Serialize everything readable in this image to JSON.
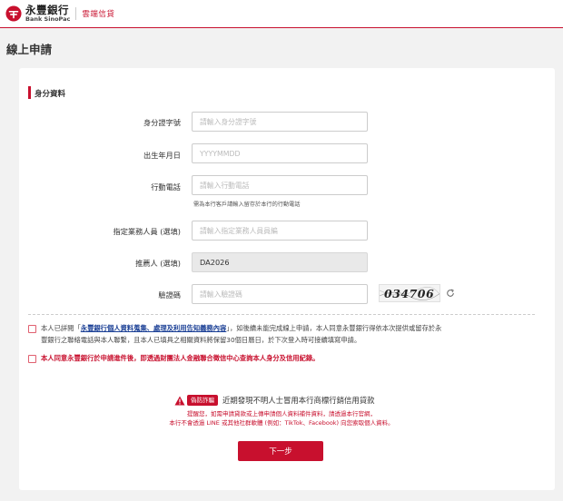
{
  "header": {
    "brand_cn": "永豐銀行",
    "brand_en": "Bank SinoPac",
    "sub_brand": "雲端信貸",
    "logo_icon": "sinopac-logo-icon",
    "accent_color": "#c8102e"
  },
  "page_title": "線上申請",
  "section": {
    "title": "身分資料"
  },
  "form": {
    "id_number": {
      "label": "身分證字號",
      "placeholder": "請輸入身分證字號"
    },
    "birth_date": {
      "label": "出生年月日",
      "placeholder": "YYYYMMDD"
    },
    "mobile": {
      "label": "行動電話",
      "placeholder": "請輸入行動電話",
      "hint": "需為本行客戶請輸入留存於本行的行動電話"
    },
    "agent": {
      "label": "指定業務人員 (選填)",
      "placeholder": "請輸入指定業務人員員編"
    },
    "referrer": {
      "label": "推薦人 (選填)",
      "value": "DA2026"
    },
    "captcha": {
      "label": "驗證碼",
      "placeholder": "請輸入驗證碼",
      "image_text": "034706",
      "refresh_icon": "refresh-icon"
    }
  },
  "consent": {
    "c1_prefix": "本人已詳閱「",
    "c1_link": "永豐銀行個人資料蒐集、處理及利用告知義務內容",
    "c1_suffix": "」，如後續未能完成線上申請，本人同意永豐銀行得依本次提供或留存於永",
    "c1_line2": "豐銀行之聯絡電話與本人聯繫，且本人已填具之相關資料將保留30個日曆日，於下次登入時可接續填寫申請。",
    "c2": "本人同意永豐銀行於申請進件後，即透過財團法人金融聯合徵信中心查詢本人身分及信用紀錄。"
  },
  "warning": {
    "badge": "偽防詐騙",
    "title": "近期發現不明人士冒用本行商標行銷信用貸款",
    "line1": "提醒您，如需申請貸款或上傳申請個人資料補件資料，請透過本行官網，",
    "line2": "本行不會透過 LINE 或其他社群軟體 (例如：TikTok、Facebook) 向您索取個人資料。",
    "icon": "warning-triangle-icon"
  },
  "next_button": "下一步"
}
